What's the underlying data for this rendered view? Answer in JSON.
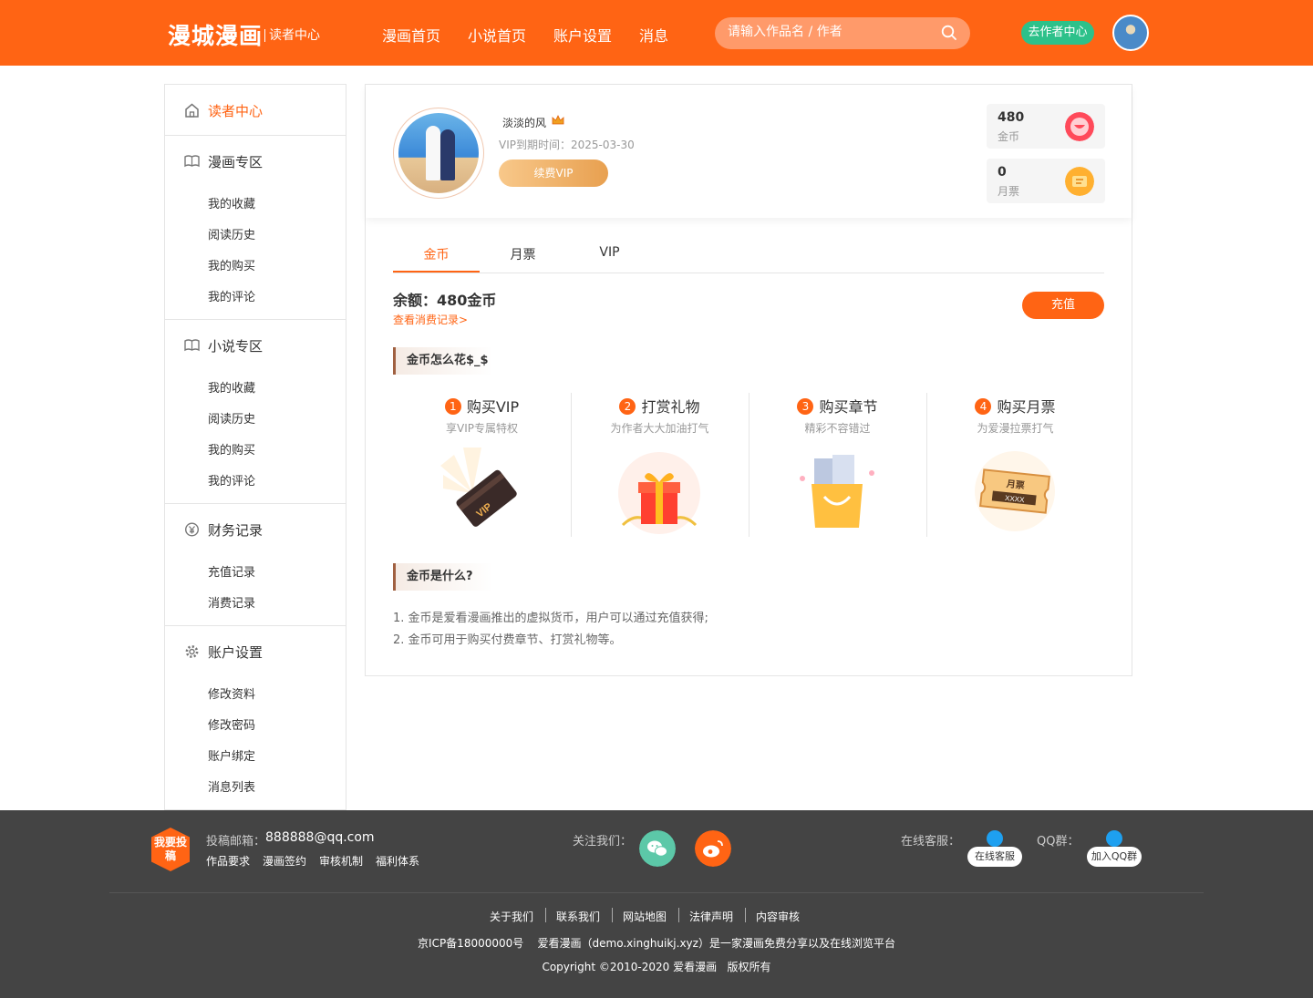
{
  "header": {
    "logo": "漫城漫画",
    "logo_sub": "读者中心",
    "nav": [
      "漫画首页",
      "小说首页",
      "账户设置",
      "消息"
    ],
    "search_placeholder": "请输入作品名 / 作者",
    "author_button": "去作者中心",
    "brand_color": "#ff6414"
  },
  "sidebar": {
    "home": "读者中心",
    "comic_zone": {
      "title": "漫画专区",
      "items": [
        "我的收藏",
        "阅读历史",
        "我的购买",
        "我的评论"
      ]
    },
    "novel_zone": {
      "title": "小说专区",
      "items": [
        "我的收藏",
        "阅读历史",
        "我的购买",
        "我的评论"
      ]
    },
    "finance": {
      "title": "财务记录",
      "items": [
        "充值记录",
        "消费记录"
      ]
    },
    "account": {
      "title": "账户设置",
      "items": [
        "修改资料",
        "修改密码",
        "账户绑定",
        "消息列表"
      ]
    }
  },
  "profile": {
    "username": "淡淡的风",
    "vip_expiry": "VIP到期时间：2025-03-30",
    "renew_button": "续费VIP",
    "coins_value": "480",
    "coins_label": "金币",
    "tickets_value": "0",
    "tickets_label": "月票"
  },
  "tabs": [
    "金币",
    "月票",
    "VIP"
  ],
  "balance": {
    "text": "余额：480金币",
    "records_link": "查看消费记录>",
    "recharge_button": "充值"
  },
  "how_to_spend": {
    "title": "金币怎么花$_$",
    "cards": [
      {
        "num": "1",
        "title": "购买VIP",
        "desc": "享VIP专属特权"
      },
      {
        "num": "2",
        "title": "打赏礼物",
        "desc": "为作者大大加油打气"
      },
      {
        "num": "3",
        "title": "购买章节",
        "desc": "精彩不容错过"
      },
      {
        "num": "4",
        "title": "购买月票",
        "desc": "为爱漫拉票打气"
      }
    ],
    "vip_card_text": "VIP",
    "ticket_card_title": "月票",
    "ticket_card_text": "XXXX"
  },
  "what_is": {
    "title": "金币是什么?",
    "lines": [
      "1. 金币是爱看漫画推出的虚拟货币，用户可以通过充值获得;",
      "2. 金币可用于购买付费章节、打赏礼物等。"
    ]
  },
  "footer": {
    "submit_badge": "我要投稿",
    "email_label": "投稿邮箱：",
    "email": "888888@qq.com",
    "links": [
      "作品要求",
      "漫画签约",
      "审核机制",
      "福利体系"
    ],
    "follow_label": "关注我们：",
    "service_label": "在线客服：",
    "service_pill": "在线客服",
    "qq_label": "QQ群：",
    "qq_pill": "加入QQ群",
    "bottom_links": [
      "关于我们",
      "联系我们",
      "网站地图",
      "法律声明",
      "内容审核"
    ],
    "icp": "京ICP备18000000号    爱看漫画（demo.xinghuikj.xyz）是一家漫画免费分享以及在线浏览平台",
    "copyright": "Copyright ©2010-2020 爱看漫画   版权所有"
  }
}
